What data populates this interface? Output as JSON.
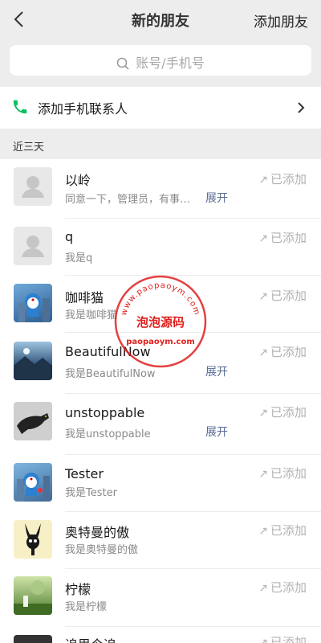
{
  "header": {
    "title": "新的朋友",
    "add_friend": "添加朋友"
  },
  "search": {
    "placeholder": "账号/手机号"
  },
  "phone_contacts": {
    "label": "添加手机联系人"
  },
  "section": {
    "label": "近三天"
  },
  "items": [
    {
      "name": "以岭",
      "message": "同意一下，管理员，有事…",
      "expand": "展开",
      "status": "已添加",
      "avatar": "default-avatar"
    },
    {
      "name": "q",
      "message": "我是q",
      "expand": "",
      "status": "已添加",
      "avatar": "default-avatar"
    },
    {
      "name": "咖啡猫",
      "message": "我是咖啡猫",
      "expand": "",
      "status": "已添加",
      "avatar": "cartoon-robot"
    },
    {
      "name": "BeautifulNow",
      "message": "我是BeautifulNow",
      "expand": "展开",
      "status": "已添加",
      "avatar": "landscape-photo"
    },
    {
      "name": "unstoppable",
      "message": "我是unstoppable",
      "expand": "展开",
      "status": "已添加",
      "avatar": "panther"
    },
    {
      "name": "Tester",
      "message": "我是Tester",
      "expand": "",
      "status": "已添加",
      "avatar": "cartoon-robot"
    },
    {
      "name": "奥特曼的傲",
      "message": "我是奥特曼的傲",
      "expand": "",
      "status": "已添加",
      "avatar": "bunny-silhouette"
    },
    {
      "name": "柠檬",
      "message": "我是柠檬",
      "expand": "",
      "status": "已添加",
      "avatar": "green-photo"
    },
    {
      "name": "追思今追",
      "message": "",
      "expand": "",
      "status": "已添加",
      "avatar": "dark-photo"
    }
  ],
  "watermark": {
    "top": "www.paopaoym.com",
    "center": "泡泡源码",
    "bottom": "paopaoym.com"
  },
  "colors": {
    "link": "#576b95",
    "muted": "#b2b2b2",
    "phone_green": "#07c160",
    "stamp_red": "#e0201e"
  }
}
